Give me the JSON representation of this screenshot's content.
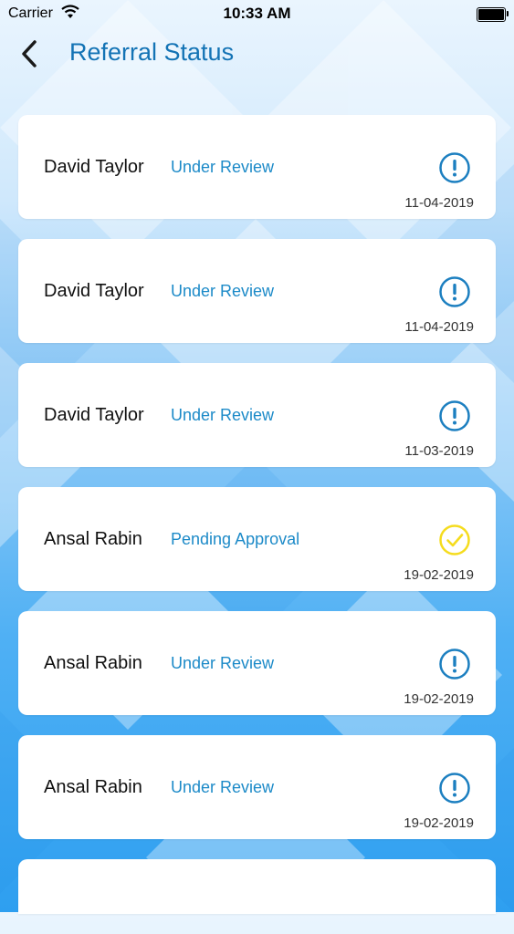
{
  "status_bar": {
    "carrier": "Carrier",
    "time": "10:33 AM"
  },
  "nav": {
    "title": "Referral Status"
  },
  "referrals": [
    {
      "name": "David Taylor",
      "status": "Under Review",
      "date": "11-04-2019",
      "icon": "alert-icon"
    },
    {
      "name": "David Taylor",
      "status": "Under Review",
      "date": "11-04-2019",
      "icon": "alert-icon"
    },
    {
      "name": "David Taylor",
      "status": "Under Review",
      "date": "11-03-2019",
      "icon": "alert-icon"
    },
    {
      "name": "Ansal Rabin",
      "status": "Pending Approval",
      "date": "19-02-2019",
      "icon": "check-icon"
    },
    {
      "name": "Ansal Rabin",
      "status": "Under Review",
      "date": "19-02-2019",
      "icon": "alert-icon"
    },
    {
      "name": "Ansal Rabin",
      "status": "Under Review",
      "date": "19-02-2019",
      "icon": "alert-icon"
    }
  ],
  "colors": {
    "title": "#1373b5",
    "status": "#1c8ac8",
    "alert": "#1c7fc0",
    "check": "#f5dc1e"
  }
}
